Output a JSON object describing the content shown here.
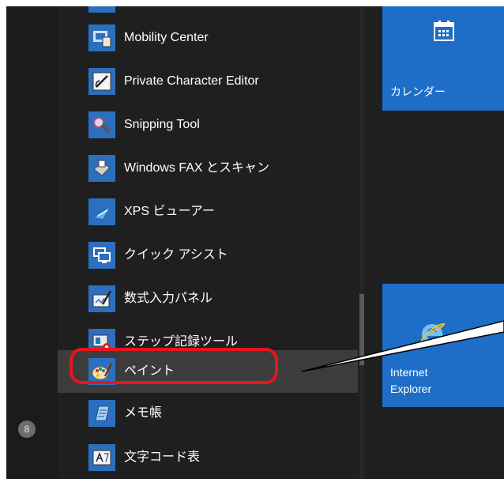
{
  "start_menu": {
    "user": {
      "avatar_glyph": "8"
    },
    "apps": [
      {
        "label": "Mobility Center",
        "icon": "mobility-center-icon"
      },
      {
        "label": "Private Character Editor",
        "icon": "private-character-editor-icon"
      },
      {
        "label": "Snipping Tool",
        "icon": "snipping-tool-icon"
      },
      {
        "label": "Windows FAX とスキャン",
        "icon": "fax-scan-icon"
      },
      {
        "label": "XPS ビューアー",
        "icon": "xps-viewer-icon"
      },
      {
        "label": "クイック アシスト",
        "icon": "quick-assist-icon"
      },
      {
        "label": "数式入力パネル",
        "icon": "math-input-panel-icon"
      },
      {
        "label": "ステップ記録ツール",
        "icon": "steps-recorder-icon"
      },
      {
        "label": "ペイント",
        "icon": "paint-icon",
        "highlighted": true
      },
      {
        "label": "メモ帳",
        "icon": "notepad-icon"
      },
      {
        "label": "文字コード表",
        "icon": "character-map-icon"
      }
    ],
    "tiles": {
      "calendar": {
        "label": "カレンダー",
        "icon": "calendar-icon"
      },
      "ie": {
        "label_line1": "Internet",
        "label_line2": "Explorer",
        "icon": "internet-explorer-icon"
      }
    },
    "colors": {
      "background": "#1f1f1f",
      "tile_blue": "#1e6ec8",
      "highlight_ring": "#e8141c",
      "selected_row": "#3c3c3c"
    }
  }
}
